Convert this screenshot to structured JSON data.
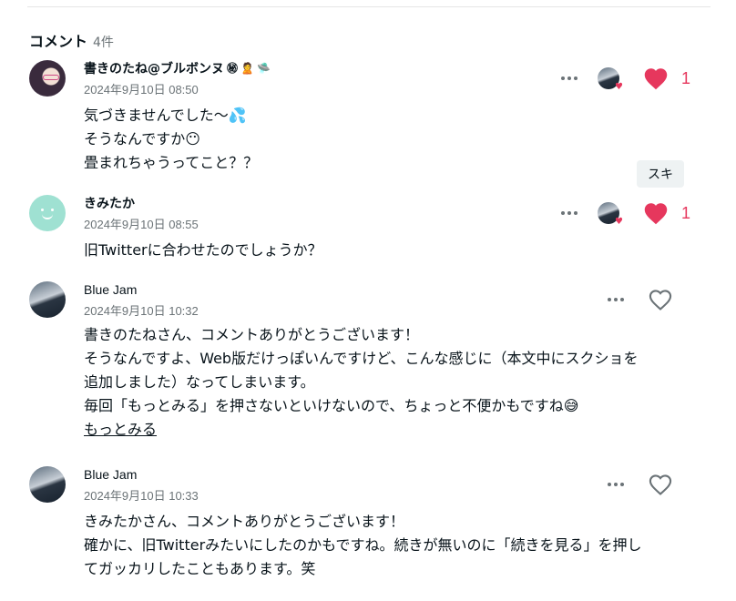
{
  "section": {
    "title": "コメント",
    "count": "4件"
  },
  "tooltip": "スキ",
  "comments": [
    {
      "name": "書きのたね@ブルボンヌ",
      "name_decorations": [
        "㊙",
        "🙎",
        "🛸"
      ],
      "date": "2024年9月10日 08:50",
      "lines": [
        "気づきませんでした～",
        "そうなんですか",
        "畳まれちゃうってこと？？"
      ],
      "line_emoji": [
        "💦",
        "😶",
        ""
      ],
      "liked": true,
      "like_count": "1",
      "has_liker": true
    },
    {
      "name": "きみたか",
      "date": "2024年9月10日 08:55",
      "lines": [
        "旧Twitterに合わせたのでしょうか？"
      ],
      "liked": true,
      "like_count": "1",
      "has_liker": true
    },
    {
      "name": "Blue Jam",
      "date": "2024年9月10日 10:32",
      "lines": [
        "書きのたねさん、コメントありがとうございます！",
        "そうなんですよ、Web版だけっぽいんですけど、こんな感じに（本文中にスクショを",
        "追加しました）なってしまいます。",
        "毎回「もっとみる」を押さないといけないので、ちょっと不便かもですね😅"
      ],
      "more_label": "もっとみる",
      "liked": false
    },
    {
      "name": "Blue Jam",
      "date": "2024年9月10日 10:33",
      "lines": [
        "きみたかさん、コメントありがとうございます！",
        "確かに、旧Twitterみたいにしたのかもですね。続きが無いのに「続きを見る」を押し",
        "てガッカリしたこともあります。笑"
      ],
      "liked": false
    }
  ],
  "colors": {
    "accent": "#e6375d",
    "muted": "#6b7377",
    "text": "#08131a"
  }
}
